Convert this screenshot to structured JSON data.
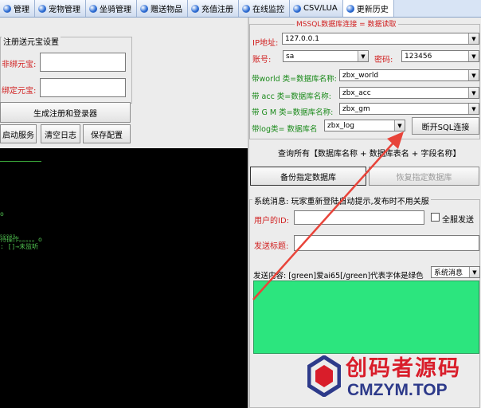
{
  "tabs": [
    {
      "label": "管理",
      "icon": "tab-globe-icon",
      "active": false
    },
    {
      "label": "宠物管理",
      "icon": "tab-globe-icon",
      "active": false
    },
    {
      "label": "坐骑管理",
      "icon": "tab-globe-icon",
      "active": false
    },
    {
      "label": "赠送物品",
      "icon": "tab-globe-icon",
      "active": false
    },
    {
      "label": "充值注册",
      "icon": "tab-globe-icon",
      "active": false
    },
    {
      "label": "在线监控",
      "icon": "tab-globe-icon",
      "active": false
    },
    {
      "label": "CSV/LUA",
      "icon": "tab-globe-icon",
      "active": false
    },
    {
      "label": "更新历史",
      "icon": "tab-globe-icon",
      "active": true
    }
  ],
  "left": {
    "group_title": "注册送元宝设置",
    "nonbound_label": "非绑元宝:",
    "nonbound_value": "",
    "bound_label": "绑定元宝:",
    "bound_value": "",
    "gen_button": "生成注册和登录器",
    "start_button": "启动服务",
    "clear_button": "清空日志",
    "save_button": "保存配置"
  },
  "console": {
    "lines": [
      "o",
      "。。。。。",
      "待操作。。。。。o",
      ": []→未监听"
    ]
  },
  "sql": {
    "title": "MSSQL数据库连接 = 数据读取",
    "ip_label": "IP地址:",
    "ip_value": "127.0.0.1",
    "account_label": "账号:",
    "account_value": "sa",
    "password_label": "密码:",
    "password_value": "123456",
    "world_label": "带world 类=数据库名称:",
    "world_value": "zbx_world",
    "acc_label": "带 acc 类=数据库名称:",
    "acc_value": "zbx_acc",
    "gm_label": "带 G M 类=数据库名称:",
    "gm_value": "zbx_gm",
    "log_label": "带log类= 数据库名",
    "log_value": "zbx_log",
    "disconnect_button": "断开SQL连接"
  },
  "query_all_text": "查询所有【数据库名称 + 数据库表名 + 字段名称】",
  "backup_button": "备份指定数据库",
  "restore_button": "恢复指定数据库",
  "msg": {
    "group_title": "系统消息: 玩家重新登陆自动提示,发布时不用关服",
    "user_id_label": "用户的ID:",
    "user_id_value": "",
    "all_send_label": "全服发送",
    "send_title_label": "发送标题:",
    "send_title_value": "",
    "send_content_label": "发送内容: [green]爱ai65[/green]代表字体是绿色",
    "type_value": "系统消息",
    "content_bg": "#2ce57e"
  },
  "watermark": {
    "cn_text": "创码者源码",
    "en_text": "CMZYM.TOP",
    "color": "#d91d2a"
  },
  "colors": {
    "arrow": "#e8443a",
    "console_text": "#4fc04f"
  }
}
